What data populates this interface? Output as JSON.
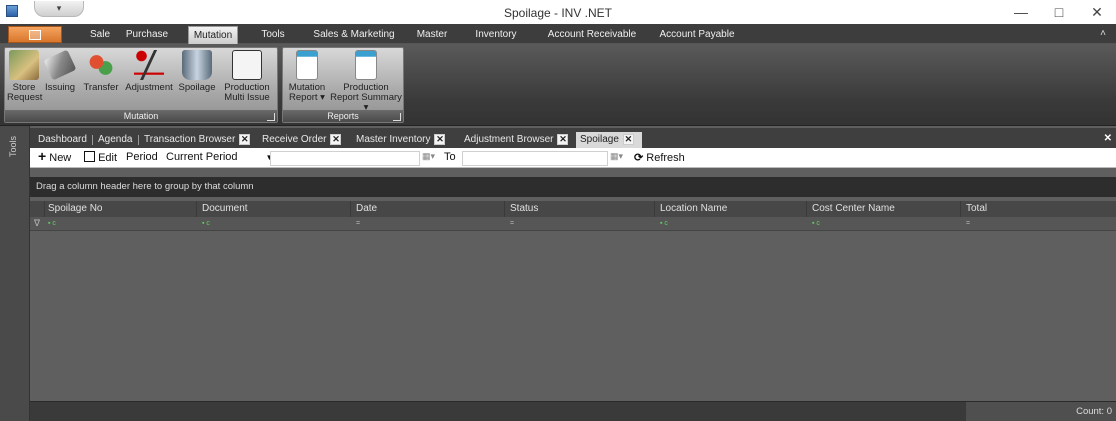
{
  "window": {
    "title": "Spoilage - INV .NET",
    "qat_label": "▾",
    "controls": [
      "—",
      "□",
      "✕"
    ]
  },
  "ribbon_tabs": [
    "Sale",
    "Purchase",
    "Mutation",
    "Tools",
    "Sales & Marketing",
    "Master",
    "Inventory",
    "Account Receivable",
    "Account Payable"
  ],
  "active_ribbon_tab": "Mutation",
  "collapse_label": "˄",
  "ribbon_groups": {
    "mutation": {
      "label": "Mutation",
      "buttons": [
        {
          "line1": "Store",
          "line2": "Request"
        },
        {
          "line1": "Issuing",
          "line2": ""
        },
        {
          "line1": "Transfer",
          "line2": ""
        },
        {
          "line1": "Adjustment",
          "line2": ""
        },
        {
          "line1": "Spoilage",
          "line2": ""
        },
        {
          "line1": "Production",
          "line2": "Multi Issue"
        }
      ]
    },
    "reports": {
      "label": "Reports",
      "buttons": [
        {
          "line1": "Mutation",
          "line2": "Report ▾"
        },
        {
          "line1": "Production",
          "line2": "Report Summary ▾"
        }
      ]
    }
  },
  "tools_label": "Tools",
  "doc_tabs": [
    {
      "label": "Dashboard",
      "closable": false
    },
    {
      "label": "Agenda",
      "closable": false
    },
    {
      "label": "Transaction Browser",
      "closable": true
    },
    {
      "label": "Receive Order",
      "closable": true
    },
    {
      "label": "Master Inventory",
      "closable": true
    },
    {
      "label": "Adjustment Browser",
      "closable": true
    },
    {
      "label": "Spoilage",
      "closable": true
    }
  ],
  "close_glyph": "✕",
  "toolbar": {
    "new_label": "New",
    "edit_label": "Edit",
    "period_label": "Period",
    "current_period": "Current Period",
    "to_label": "To",
    "refresh_label": "Refresh",
    "from_value": "",
    "to_value": ""
  },
  "group_hint": "Drag a column header here to group by that column",
  "grid": {
    "columns": [
      "Spoilage No",
      "Document",
      "Date",
      "Status",
      "Location Name",
      "Cost Center Name",
      "Total"
    ],
    "filter_kinds": [
      "green",
      "green",
      "dash",
      "dash",
      "green",
      "green",
      "dash"
    ],
    "filter_green": "▪ c",
    "filter_dash": "=",
    "filter_icon": "∇",
    "rows": []
  },
  "footer": {
    "count_label": "Count: 0"
  }
}
